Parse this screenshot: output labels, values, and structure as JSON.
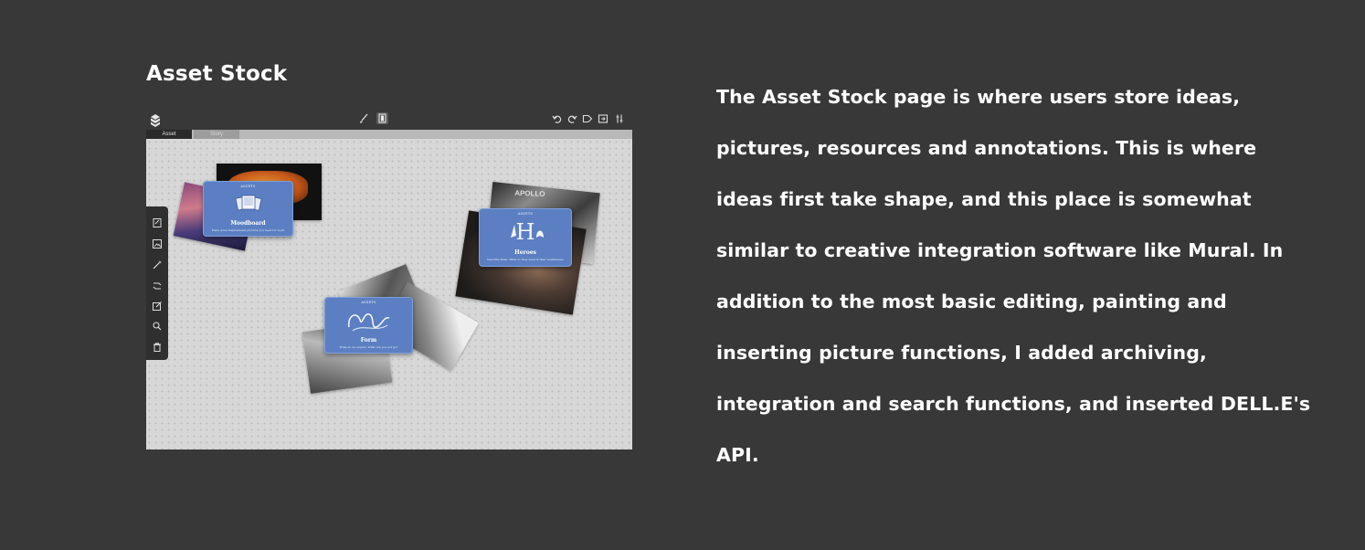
{
  "section": {
    "title": "Asset Stock"
  },
  "app": {
    "tabs": [
      {
        "label": "Asset"
      },
      {
        "label": "Story"
      }
    ],
    "toolbar": {
      "icons": [
        "logo-icon",
        "brush-icon",
        "layers-icon",
        "undo-icon",
        "redo-icon",
        "tag-icon",
        "export-icon",
        "settings-icon"
      ]
    },
    "side_tools": [
      "note-icon",
      "image-icon",
      "magic-icon",
      "link-icon",
      "edit-icon",
      "search-icon",
      "trash-icon"
    ],
    "cards": [
      {
        "tag": "ASSETS",
        "name": "Moodboard",
        "desc": "Place some inspirational pictures you need for work"
      },
      {
        "tag": "ASSETS",
        "name": "Heroes",
        "desc": "Describe them: What do they need & their weaknesses"
      },
      {
        "tag": "ASSETS",
        "name": "Form",
        "desc": "What do we expect: What can you not go?"
      }
    ],
    "colors": {
      "card": "#5b7fc2",
      "canvas": "#d7d7d7",
      "chrome": "#383838"
    }
  },
  "description": {
    "text": "The Asset Stock page is where users store ideas, pictures, resources and annotations. This is where ideas first take shape, and this place is somewhat similar to creative integration software like Mural. In addition to the most basic editing, painting and inserting picture functions, I added archiving, integration and search functions, and inserted DELL.E's API."
  }
}
